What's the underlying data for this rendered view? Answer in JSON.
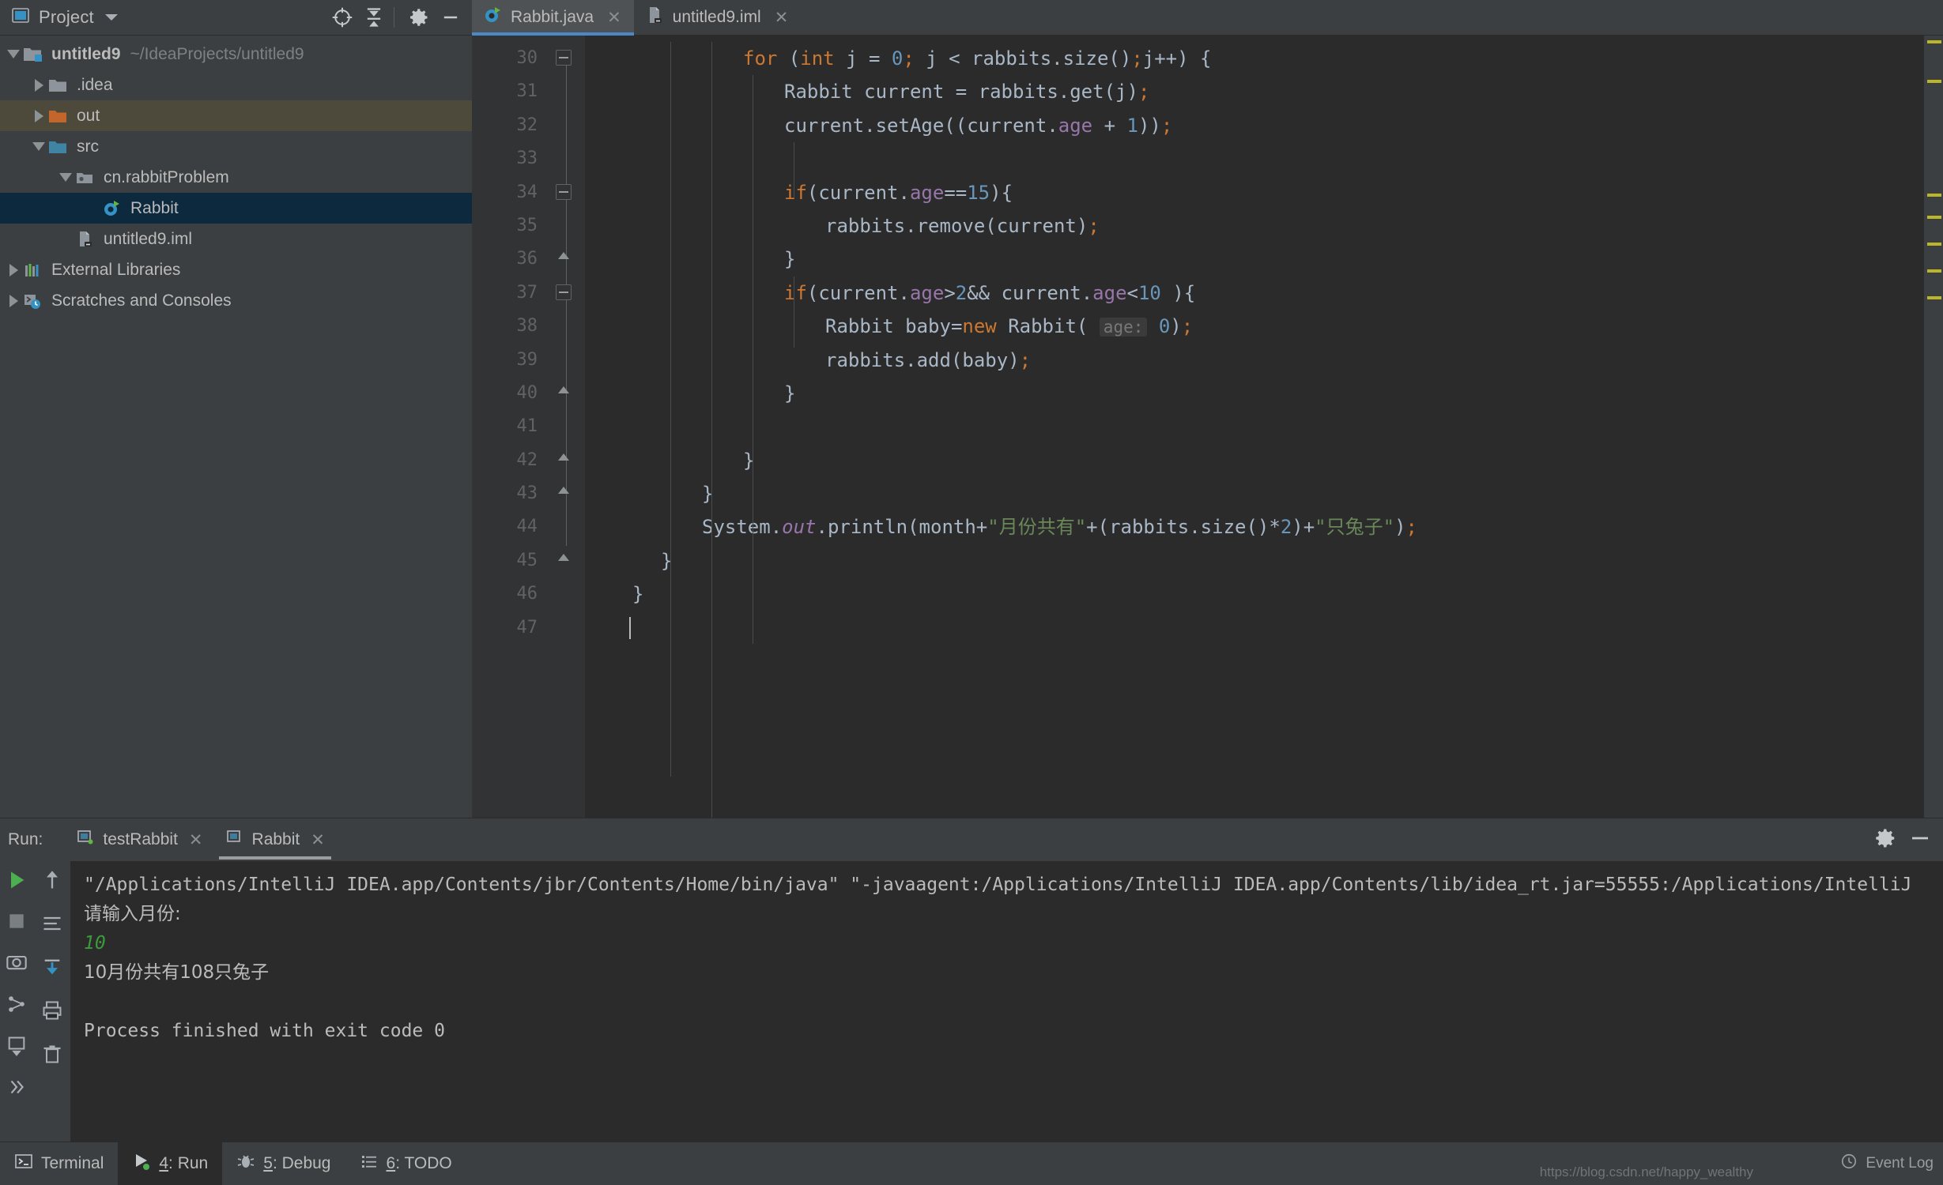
{
  "window": {
    "project_panel_title": "Project",
    "header_icons": [
      "locate-icon",
      "collapse-all-icon",
      "gear-icon",
      "minimize-icon"
    ]
  },
  "project_tree": {
    "items": [
      {
        "label": "untitled9",
        "sub": "~/IdeaProjects/untitled9",
        "icon": "project-folder-icon",
        "depth": 0,
        "twisty": "down",
        "state": "normal",
        "bold": true
      },
      {
        "label": ".idea",
        "sub": "",
        "icon": "folder-gray-icon",
        "depth": 1,
        "twisty": "right",
        "state": "normal",
        "bold": false
      },
      {
        "label": "out",
        "sub": "",
        "icon": "folder-orange-icon",
        "depth": 1,
        "twisty": "right",
        "state": "olive",
        "bold": false
      },
      {
        "label": "src",
        "sub": "",
        "icon": "folder-blue-icon",
        "depth": 1,
        "twisty": "down",
        "state": "normal",
        "bold": false
      },
      {
        "label": "cn.rabbitProblem",
        "sub": "",
        "icon": "package-icon",
        "depth": 2,
        "twisty": "down",
        "state": "normal",
        "bold": false
      },
      {
        "label": "Rabbit",
        "sub": "",
        "icon": "java-class-icon",
        "depth": 3,
        "twisty": "none",
        "state": "selected",
        "bold": false
      },
      {
        "label": "untitled9.iml",
        "sub": "",
        "icon": "iml-file-icon",
        "depth": 2,
        "twisty": "none",
        "state": "normal",
        "bold": false
      },
      {
        "label": "External Libraries",
        "sub": "",
        "icon": "libraries-icon",
        "depth": 0,
        "twisty": "right",
        "state": "normal",
        "bold": false
      },
      {
        "label": "Scratches and Consoles",
        "sub": "",
        "icon": "scratches-icon",
        "depth": 0,
        "twisty": "right",
        "state": "normal",
        "bold": false
      }
    ]
  },
  "editor": {
    "tabs": [
      {
        "label": "Rabbit.java",
        "icon": "java-class-icon",
        "active": true
      },
      {
        "label": "untitled9.iml",
        "icon": "iml-file-icon",
        "active": false
      }
    ],
    "first_line_number": 30,
    "line_numbers": [
      30,
      31,
      32,
      33,
      34,
      35,
      36,
      37,
      38,
      39,
      40,
      41,
      42,
      43,
      44,
      45,
      46,
      47
    ],
    "lines": [
      "            for (int j = 0; j < rabbits.size();j++) {",
      "                Rabbit current = rabbits.get(j);",
      "                current.setAge((current.age + 1));",
      "",
      "                if(current.age==15){",
      "                    rabbits.remove(current);",
      "                }",
      "                if(current.age>2&& current.age<10 ){",
      "                    Rabbit baby=new Rabbit( age: 0);",
      "                    rabbits.add(baby);",
      "                }",
      "",
      "            }",
      "        }",
      "        System.out.println(month+\"月份共有\"+(rabbits.size()*2)+\"只兔子\");",
      "    }",
      "}",
      ""
    ],
    "hint_parameter_label": "age:",
    "println_string_1": "月份共有",
    "println_string_2": "只兔子"
  },
  "run_window": {
    "title": "Run:",
    "tabs": [
      {
        "label": "testRabbit",
        "running": true,
        "active": false
      },
      {
        "label": "Rabbit",
        "running": false,
        "active": true
      }
    ],
    "toolbar_icons": [
      "rerun-icon",
      "up-arrow-icon",
      "camera-icon",
      "soft-wrap-icon",
      "thread-dump-icon",
      "scroll-to-end-icon",
      "export-icon",
      "print-icon",
      "trash-icon",
      "more-icon"
    ],
    "settings_icon": "gear-icon",
    "minimize_icon": "minimize-icon",
    "console_lines": [
      {
        "text": "\"/Applications/IntelliJ IDEA.app/Contents/jbr/Contents/Home/bin/java\" \"-javaagent:/Applications/IntelliJ IDEA.app/Contents/lib/idea_rt.jar=55555:/Applications/IntelliJ",
        "style": "normal"
      },
      {
        "text": "请输入月份:",
        "style": "cjk"
      },
      {
        "text": "10",
        "style": "green"
      },
      {
        "text": "10月份共有108只兔子",
        "style": "cjk"
      },
      {
        "text": "",
        "style": "normal"
      },
      {
        "text": "Process finished with exit code 0",
        "style": "normal"
      }
    ]
  },
  "status_bar": {
    "items": [
      {
        "label": "Terminal",
        "icon": "terminal-icon",
        "key": "",
        "active": false
      },
      {
        "label": ": Run",
        "icon": "run-icon",
        "key": "4",
        "active": true
      },
      {
        "label": ": Debug",
        "icon": "debug-icon",
        "key": "5",
        "active": false
      },
      {
        "label": ": TODO",
        "icon": "todo-icon",
        "key": "6",
        "active": false
      }
    ],
    "event_log_label": "Event Log",
    "event_log_icon": "event-log-icon",
    "watermark": "https://blog.csdn.net/happy_wealthy"
  },
  "colors": {
    "accent_blue": "#4a88c7",
    "selection_blue": "#0d293e",
    "olive_row": "#4e4a3b",
    "editor_bg": "#2b2b2b",
    "panel_bg": "#3c3f41",
    "keyword_orange": "#cc7832",
    "number_blue": "#6897bb",
    "string_green": "#6a8759",
    "field_purple": "#9876aa",
    "text_gray": "#a9b7c6",
    "green_run": "#4caf50"
  }
}
